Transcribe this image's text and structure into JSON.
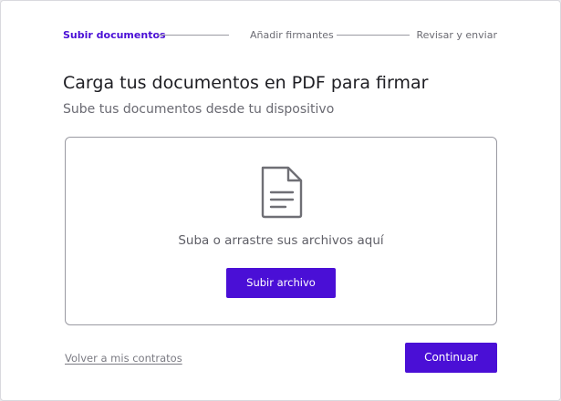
{
  "stepper": {
    "steps": [
      {
        "label": "Subir documentos",
        "state": "active"
      },
      {
        "label": "Añadir firmantes",
        "state": "pending"
      },
      {
        "label": "Revisar y enviar",
        "state": "pending"
      }
    ]
  },
  "page": {
    "title": "Carga tus documentos en PDF para firmar",
    "subtitle": "Sube tus documentos desde tu dispositivo"
  },
  "dropzone": {
    "icon": "document-icon",
    "text": "Suba o arrastre sus archivos aquí",
    "upload_label": "Subir archivo"
  },
  "footer": {
    "back_label": "Volver a mis contratos",
    "continue_label": "Continuar"
  },
  "colors": {
    "accent": "#4a0fd6",
    "text_primary": "#1d1d22",
    "text_secondary": "#6a6a72",
    "border": "#9a9aa2"
  }
}
